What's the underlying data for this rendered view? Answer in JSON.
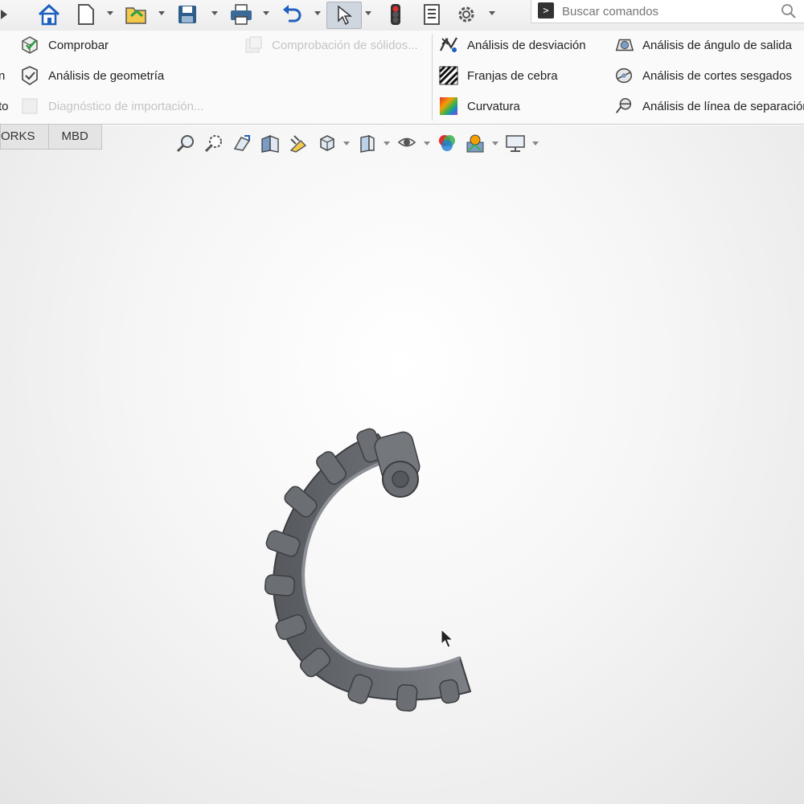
{
  "search": {
    "placeholder": "Buscar comandos"
  },
  "ribbon": {
    "col1": [
      {
        "label": "n"
      },
      {
        "label": "to"
      }
    ],
    "col2": [
      {
        "label": "Comprobar",
        "enabled": true
      },
      {
        "label": "Análisis de geometría",
        "enabled": true
      },
      {
        "label": "Diagnóstico de importación...",
        "enabled": false
      }
    ],
    "col3": [
      {
        "label": "Comprobación de sólidos...",
        "enabled": false
      }
    ],
    "col4": [
      {
        "label": "Análisis de desviación"
      },
      {
        "label": "Franjas de cebra"
      },
      {
        "label": "Curvatura"
      }
    ],
    "col5": [
      {
        "label": "Análisis de ángulo de salida"
      },
      {
        "label": "Análisis de cortes sesgados"
      },
      {
        "label": "Análisis de línea de separación"
      }
    ]
  },
  "tabs": [
    {
      "label": "ORKS"
    },
    {
      "label": "MBD"
    }
  ],
  "colors": {
    "accent": "#1f5fbf",
    "model": "#6b6e73"
  }
}
